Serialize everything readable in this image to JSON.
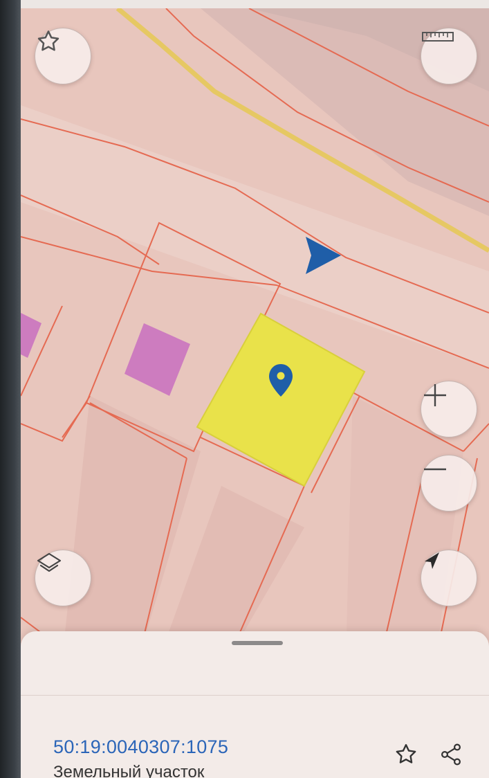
{
  "map": {
    "colors": {
      "background": "#e8c6bd",
      "parcel_border": "#e56a52",
      "road": "#e6c863",
      "selected_parcel": "#e9e24a",
      "building": "#c86fc0",
      "pin": "#1f5ea8"
    },
    "buttons": {
      "favorite": "star-icon",
      "ruler": "ruler-icon",
      "layers": "layers-icon",
      "zoom_in": "plus-icon",
      "zoom_out": "minus-icon",
      "locate": "navigation-arrow-icon"
    }
  },
  "sheet": {
    "cadastral_number": "50:19:0040307:1075",
    "object_type": "Земельный участок",
    "actions": {
      "favorite": "star-outline-icon",
      "share": "share-icon"
    }
  }
}
